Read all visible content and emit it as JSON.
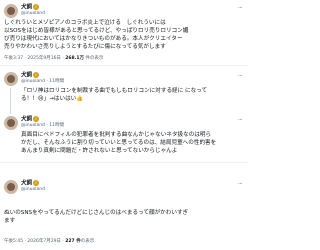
{
  "post1": {
    "name": "犬飼",
    "handle": "@inuoland",
    "lines": [
      "しぐれういとメゾピアノのコラボ炎上で泣ける　しぐれういには",
      "以SOSをはじめ皆様があると思ってるけど、やっぱりロリ売りロリコン媚",
      "び売りは現代においてはかなりきついものがある。本人がクリエイター",
      "売りやかわいさ売りしようとするたびに傷になってる気がします"
    ],
    "time": "午後3:37 · 2025年9月16日",
    "views_count": "268.1万",
    "views_label": " 件の表示"
  },
  "post2": {
    "name": "犬飼",
    "handle": "@inuoland · 11時間",
    "lines": [
      "「ロリ神はロリコンを制裁する曲でもしもロリコンに対する経に になって",
      "る！！😢」→はいはい👍"
    ]
  },
  "post3": {
    "name": "犬飼",
    "handle": "@inuoland · 11時間",
    "lines": [
      "真面目にペドフィルの犯罪者を批判する曲なんかじゃないネタ扱なのは明ら",
      "かだし、そんなふうに割り切っていいと思ってるのは、結局児童への性的害を",
      "あんまり真剣に問題だ・許されないと思ってないからじゃんよ"
    ]
  },
  "post4": {
    "name": "犬飼",
    "handle": "@inuoland",
    "lines": [
      "ぬいのSNSをやってるんだけどにじさんじのはべまるって顔がかわいすぎ",
      "ます"
    ],
    "time": "午後5:45 · 2026年7月29日",
    "views_count": "227 件",
    "views_label": "の表示"
  },
  "more_icon": "more-dots-icon",
  "verified_icon": "verified-badge-icon"
}
